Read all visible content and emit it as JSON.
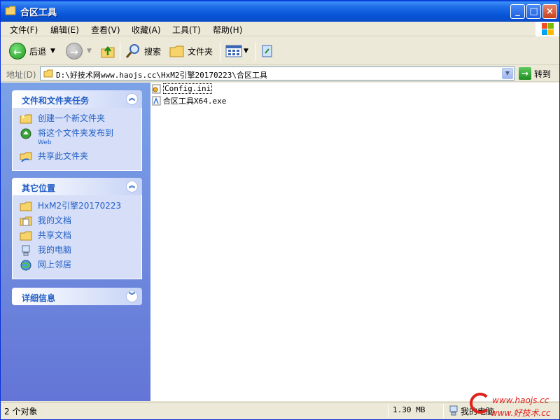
{
  "window": {
    "title": "合区工具",
    "buttons": {
      "minimize": "_",
      "maximize": "□",
      "close": "×"
    }
  },
  "menu": [
    "文件(F)",
    "编辑(E)",
    "查看(V)",
    "收藏(A)",
    "工具(T)",
    "帮助(H)"
  ],
  "toolbar": {
    "back_label": "后退",
    "search_label": "搜索",
    "folders_label": "文件夹"
  },
  "address": {
    "label": "地址(D)",
    "value": "D:\\好技术网www.haojs.cc\\HxM2引擎20170223\\合区工具",
    "go_label": "转到"
  },
  "sidebar": {
    "tasks_panel": {
      "title": "文件和文件夹任务",
      "items": [
        {
          "label": "创建一个新文件夹",
          "icon": "new-folder-icon"
        },
        {
          "label": "将这个文件夹发布到",
          "sub": "Web",
          "icon": "publish-web-icon"
        },
        {
          "label": "共享此文件夹",
          "icon": "share-folder-icon"
        }
      ]
    },
    "places_panel": {
      "title": "其它位置",
      "items": [
        {
          "label": "HxM2引擎20170223",
          "icon": "folder-icon"
        },
        {
          "label": "我的文档",
          "icon": "my-documents-icon"
        },
        {
          "label": "共享文档",
          "icon": "shared-documents-icon"
        },
        {
          "label": "我的电脑",
          "icon": "my-computer-icon"
        },
        {
          "label": "网上邻居",
          "icon": "network-places-icon"
        }
      ]
    },
    "details_panel": {
      "title": "详细信息"
    }
  },
  "files": [
    {
      "name": "Config.ini",
      "icon": "ini-file-icon",
      "selected": true
    },
    {
      "name": "合区工具X64.exe",
      "icon": "exe-file-icon",
      "selected": false
    }
  ],
  "status": {
    "count": "2 个对象",
    "size": "1.30 MB",
    "location": "我的电脑"
  },
  "watermark": {
    "line1": "www.haojs.cc",
    "line2": "www.好技术.cc"
  },
  "colors": {
    "title_bar": "#0a5fdf",
    "sidebar_top": "#7ba2e7",
    "sidebar_bottom": "#6375d6",
    "task_link": "#215dc6",
    "watermark": "#e0201a"
  }
}
